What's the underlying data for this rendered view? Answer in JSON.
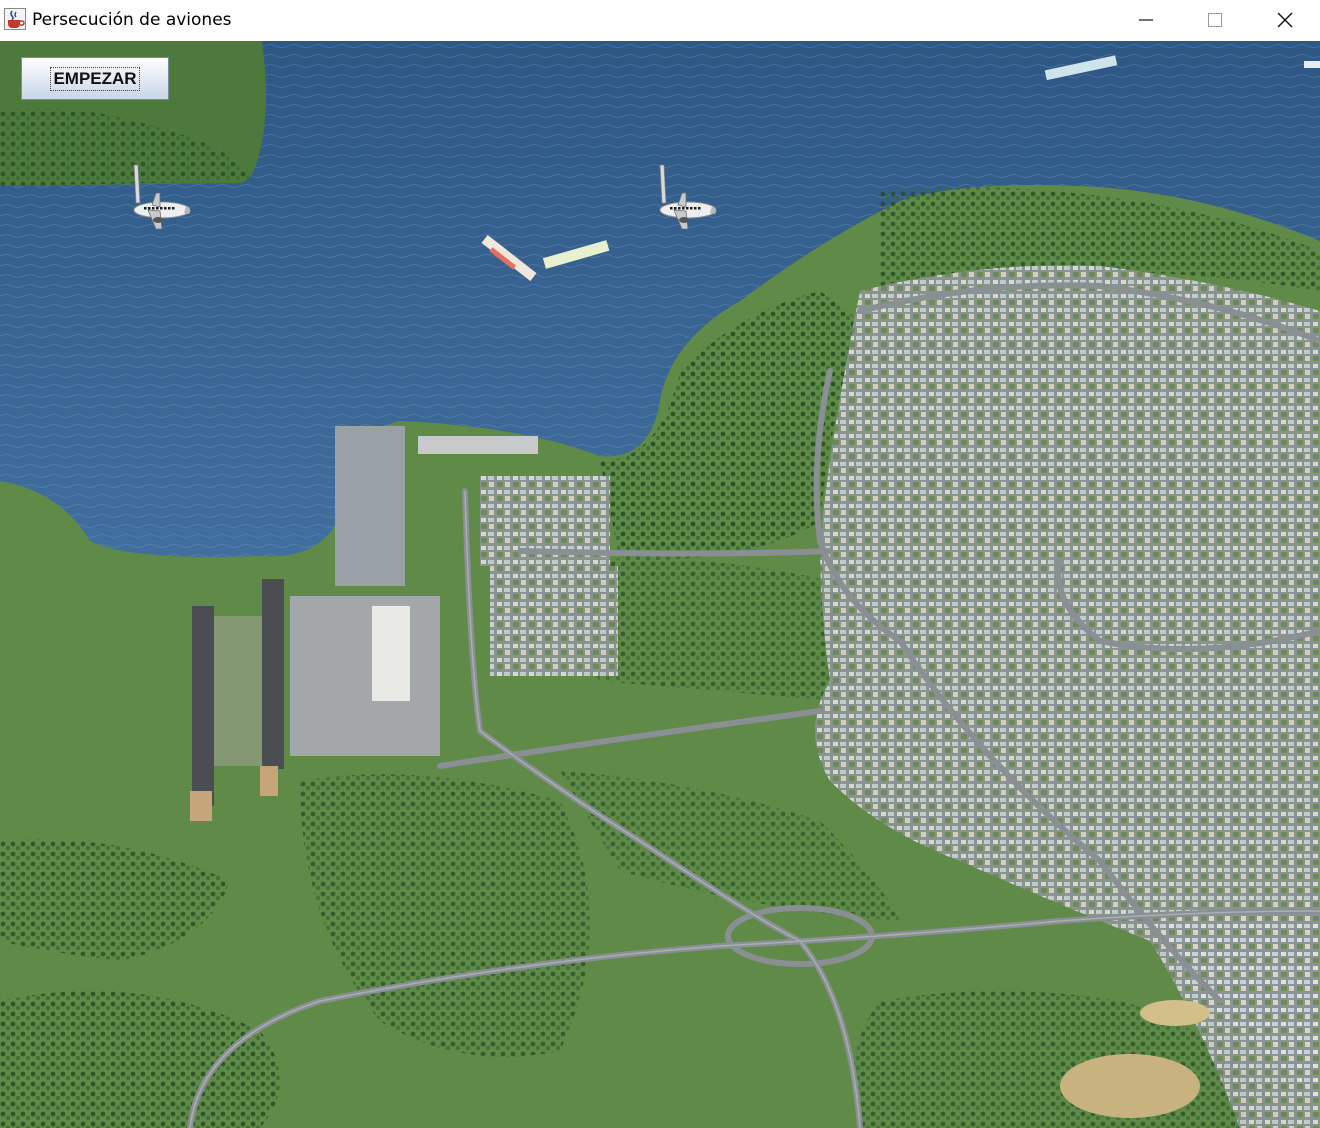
{
  "window": {
    "title": "Persecución de aviones",
    "icon": "java-coffee-cup-icon",
    "controls": [
      "minimize-icon",
      "maximize-icon",
      "close-icon"
    ]
  },
  "game": {
    "start_button_label": "EMPEZAR",
    "background": "aerial-city-airport-map",
    "player_planes": [
      "airplane-icon",
      "airplane-icon"
    ]
  },
  "colors": {
    "water": "#3f6a95",
    "land": "#5f8a48",
    "forest": "#2f5a2a",
    "city": "#b9b9b2",
    "road": "#8a8f94"
  }
}
